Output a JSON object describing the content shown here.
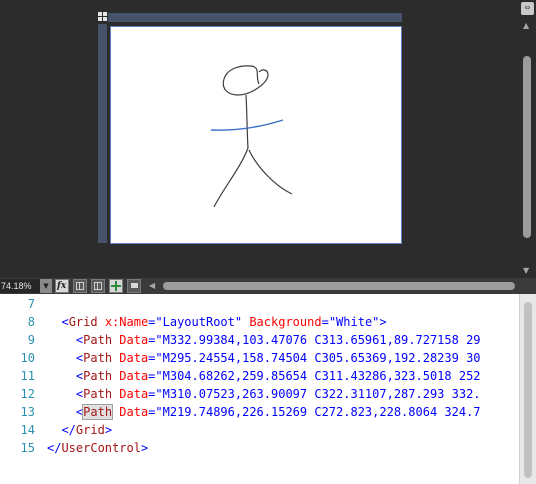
{
  "zoom": {
    "value": "74.18%"
  },
  "icons": {
    "split_view": "split-view-icon",
    "expand": "expand-icon",
    "effects": "effects-icon",
    "grid": "grid-icon",
    "snap_grid": "snap-to-grid-icon",
    "snap_lines": "snap-lines-icon",
    "annotation": "annotation-icon"
  },
  "colors": {
    "design_bg": "#2c2c2c",
    "ruler": "#47526b",
    "artboard_border": "#5d80c4",
    "stroke": "#3d3d3d",
    "arms_stroke": "#3a6fc4",
    "line_number": "#2b91af",
    "xml_tag": "#a31515",
    "xml_attr": "#ff0000",
    "xml_value": "#0000ff"
  },
  "editor": {
    "lines": [
      {
        "num": "7",
        "indent": "",
        "parts": []
      },
      {
        "num": "8",
        "indent": "  ",
        "parts": [
          {
            "t": "<",
            "c": "punc"
          },
          {
            "t": "Grid",
            "c": "tag"
          },
          {
            "t": " x:Name",
            "c": "attr"
          },
          {
            "t": "=",
            "c": "punc"
          },
          {
            "t": "\"LayoutRoot\"",
            "c": "val"
          },
          {
            "t": " Background",
            "c": "attr"
          },
          {
            "t": "=",
            "c": "punc"
          },
          {
            "t": "\"White\"",
            "c": "val"
          },
          {
            "t": ">",
            "c": "punc"
          }
        ]
      },
      {
        "num": "9",
        "indent": "    ",
        "parts": [
          {
            "t": "<",
            "c": "punc"
          },
          {
            "t": "Path",
            "c": "tag"
          },
          {
            "t": " Data",
            "c": "attr"
          },
          {
            "t": "=",
            "c": "punc"
          },
          {
            "t": "\"M332.99384,103.47076 C313.65961,89.727158 29",
            "c": "val"
          }
        ]
      },
      {
        "num": "10",
        "indent": "    ",
        "parts": [
          {
            "t": "<",
            "c": "punc"
          },
          {
            "t": "Path",
            "c": "tag"
          },
          {
            "t": " Data",
            "c": "attr"
          },
          {
            "t": "=",
            "c": "punc"
          },
          {
            "t": "\"M295.24554,158.74504 C305.65369,192.28239 30",
            "c": "val"
          }
        ]
      },
      {
        "num": "11",
        "indent": "    ",
        "parts": [
          {
            "t": "<",
            "c": "punc"
          },
          {
            "t": "Path",
            "c": "tag"
          },
          {
            "t": " Data",
            "c": "attr"
          },
          {
            "t": "=",
            "c": "punc"
          },
          {
            "t": "\"M304.68262,259.85654 C311.43286,323.5018 252",
            "c": "val"
          }
        ]
      },
      {
        "num": "12",
        "indent": "    ",
        "parts": [
          {
            "t": "<",
            "c": "punc"
          },
          {
            "t": "Path",
            "c": "tag"
          },
          {
            "t": " Data",
            "c": "attr"
          },
          {
            "t": "=",
            "c": "punc"
          },
          {
            "t": "\"M310.07523,263.90097 C322.31107,287.293 332.",
            "c": "val"
          }
        ]
      },
      {
        "num": "13",
        "indent": "    ",
        "parts": [
          {
            "t": "<",
            "c": "punc"
          },
          {
            "t": "Path",
            "c": "tag hl"
          },
          {
            "t": " Data",
            "c": "attr"
          },
          {
            "t": "=",
            "c": "punc"
          },
          {
            "t": "\"M219.74896,226.15269 C272.823,228.8064 324.7",
            "c": "val"
          }
        ]
      },
      {
        "num": "14",
        "indent": "  ",
        "parts": [
          {
            "t": "</",
            "c": "punc"
          },
          {
            "t": "Grid",
            "c": "tag"
          },
          {
            "t": ">",
            "c": "punc"
          }
        ]
      },
      {
        "num": "15",
        "indent": "",
        "parts": [
          {
            "t": "</",
            "c": "punc"
          },
          {
            "t": "UserControl",
            "c": "tag"
          },
          {
            "t": ">",
            "c": "punc"
          }
        ]
      }
    ]
  }
}
